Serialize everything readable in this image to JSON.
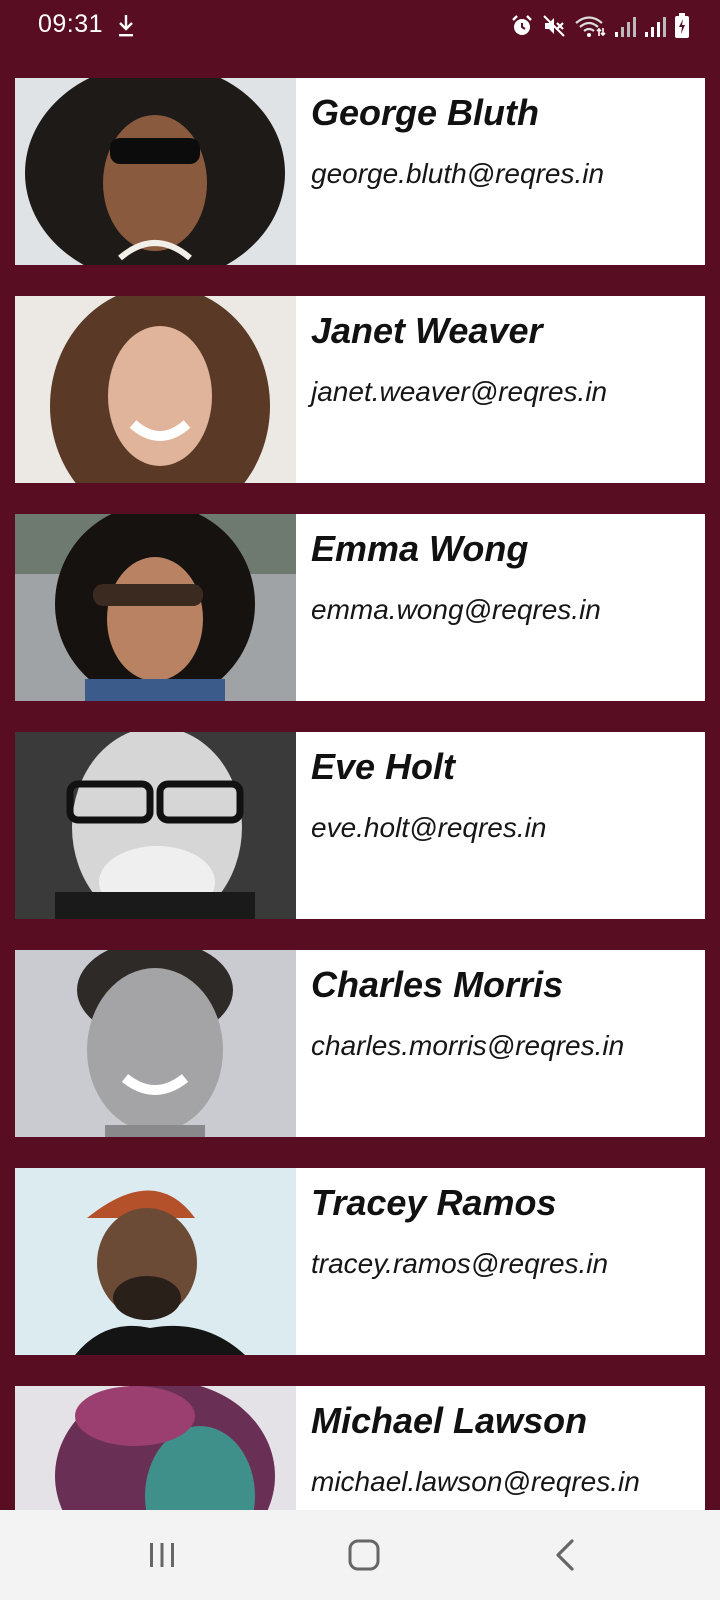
{
  "status_bar": {
    "time": "09:31",
    "icons": [
      "download-icon",
      "alarm-icon",
      "mute-icon",
      "wifi-icon",
      "signal-icon",
      "signal-icon",
      "battery-icon"
    ]
  },
  "theme": {
    "background": "#580d23",
    "card": "#ffffff"
  },
  "users": [
    {
      "name": "George Bluth",
      "email": "george.bluth@reqres.in"
    },
    {
      "name": "Janet Weaver",
      "email": "janet.weaver@reqres.in"
    },
    {
      "name": "Emma Wong",
      "email": "emma.wong@reqres.in"
    },
    {
      "name": "Eve Holt",
      "email": "eve.holt@reqres.in"
    },
    {
      "name": "Charles Morris",
      "email": "charles.morris@reqres.in"
    },
    {
      "name": "Tracey Ramos",
      "email": "tracey.ramos@reqres.in"
    },
    {
      "name": "Michael Lawson",
      "email": "michael.lawson@reqres.in"
    }
  ],
  "nav_bar": {
    "buttons": [
      "recent-apps-icon",
      "home-icon",
      "back-icon"
    ]
  }
}
